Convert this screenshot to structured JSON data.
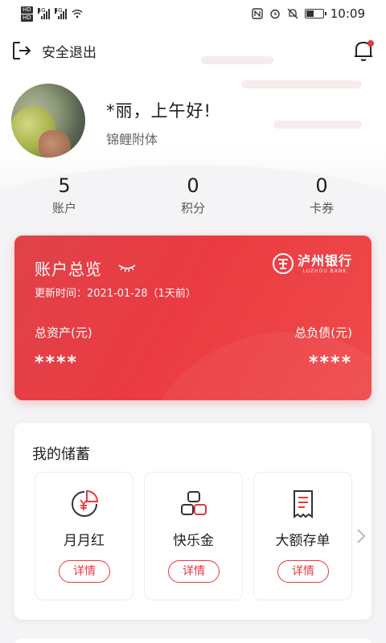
{
  "status_bar": {
    "time": "10:09",
    "network_1": "4G",
    "network_2": "4G",
    "hd_1": "HD",
    "hd_2": "HD",
    "battery_level": 0.4,
    "icons": [
      "nfc-icon",
      "alarm-icon",
      "mute-icon",
      "battery-icon",
      "wifi-icon"
    ]
  },
  "header": {
    "logout_label": "安全退出",
    "logout_icon": "logout-icon",
    "notification_icon": "bell-icon",
    "has_unread": true
  },
  "profile": {
    "greeting": "*丽，上午好!",
    "nickname": "锦鲤附体"
  },
  "stats": [
    {
      "value": "5",
      "label": "账户"
    },
    {
      "value": "0",
      "label": "积分"
    },
    {
      "value": "0",
      "label": "卡券"
    }
  ],
  "account_card": {
    "title": "账户总览",
    "eye_icon": "eye-closed-icon",
    "updated_text": "更新时间：2021-01-28（1天前）",
    "bank_name": "泸州银行",
    "bank_name_en": "LUZHOU BANK",
    "total_assets_label": "总资产(元)",
    "total_assets_value": "****",
    "total_debt_label": "总负债(元)",
    "total_debt_value": "****",
    "colors": {
      "card_red": "#ea3b41"
    }
  },
  "savings": {
    "title": "我的储蓄",
    "products": [
      {
        "name": "月月红",
        "button": "详情",
        "icon": "yuan-pie-icon"
      },
      {
        "name": "快乐金",
        "button": "详情",
        "icon": "stacked-coins-icon"
      },
      {
        "name": "大额存单",
        "button": "详情",
        "icon": "receipt-icon"
      }
    ],
    "more_icon": "chevron-right-icon"
  },
  "colors": {
    "accent": "#e8383d",
    "background": "#f4f4f6"
  }
}
